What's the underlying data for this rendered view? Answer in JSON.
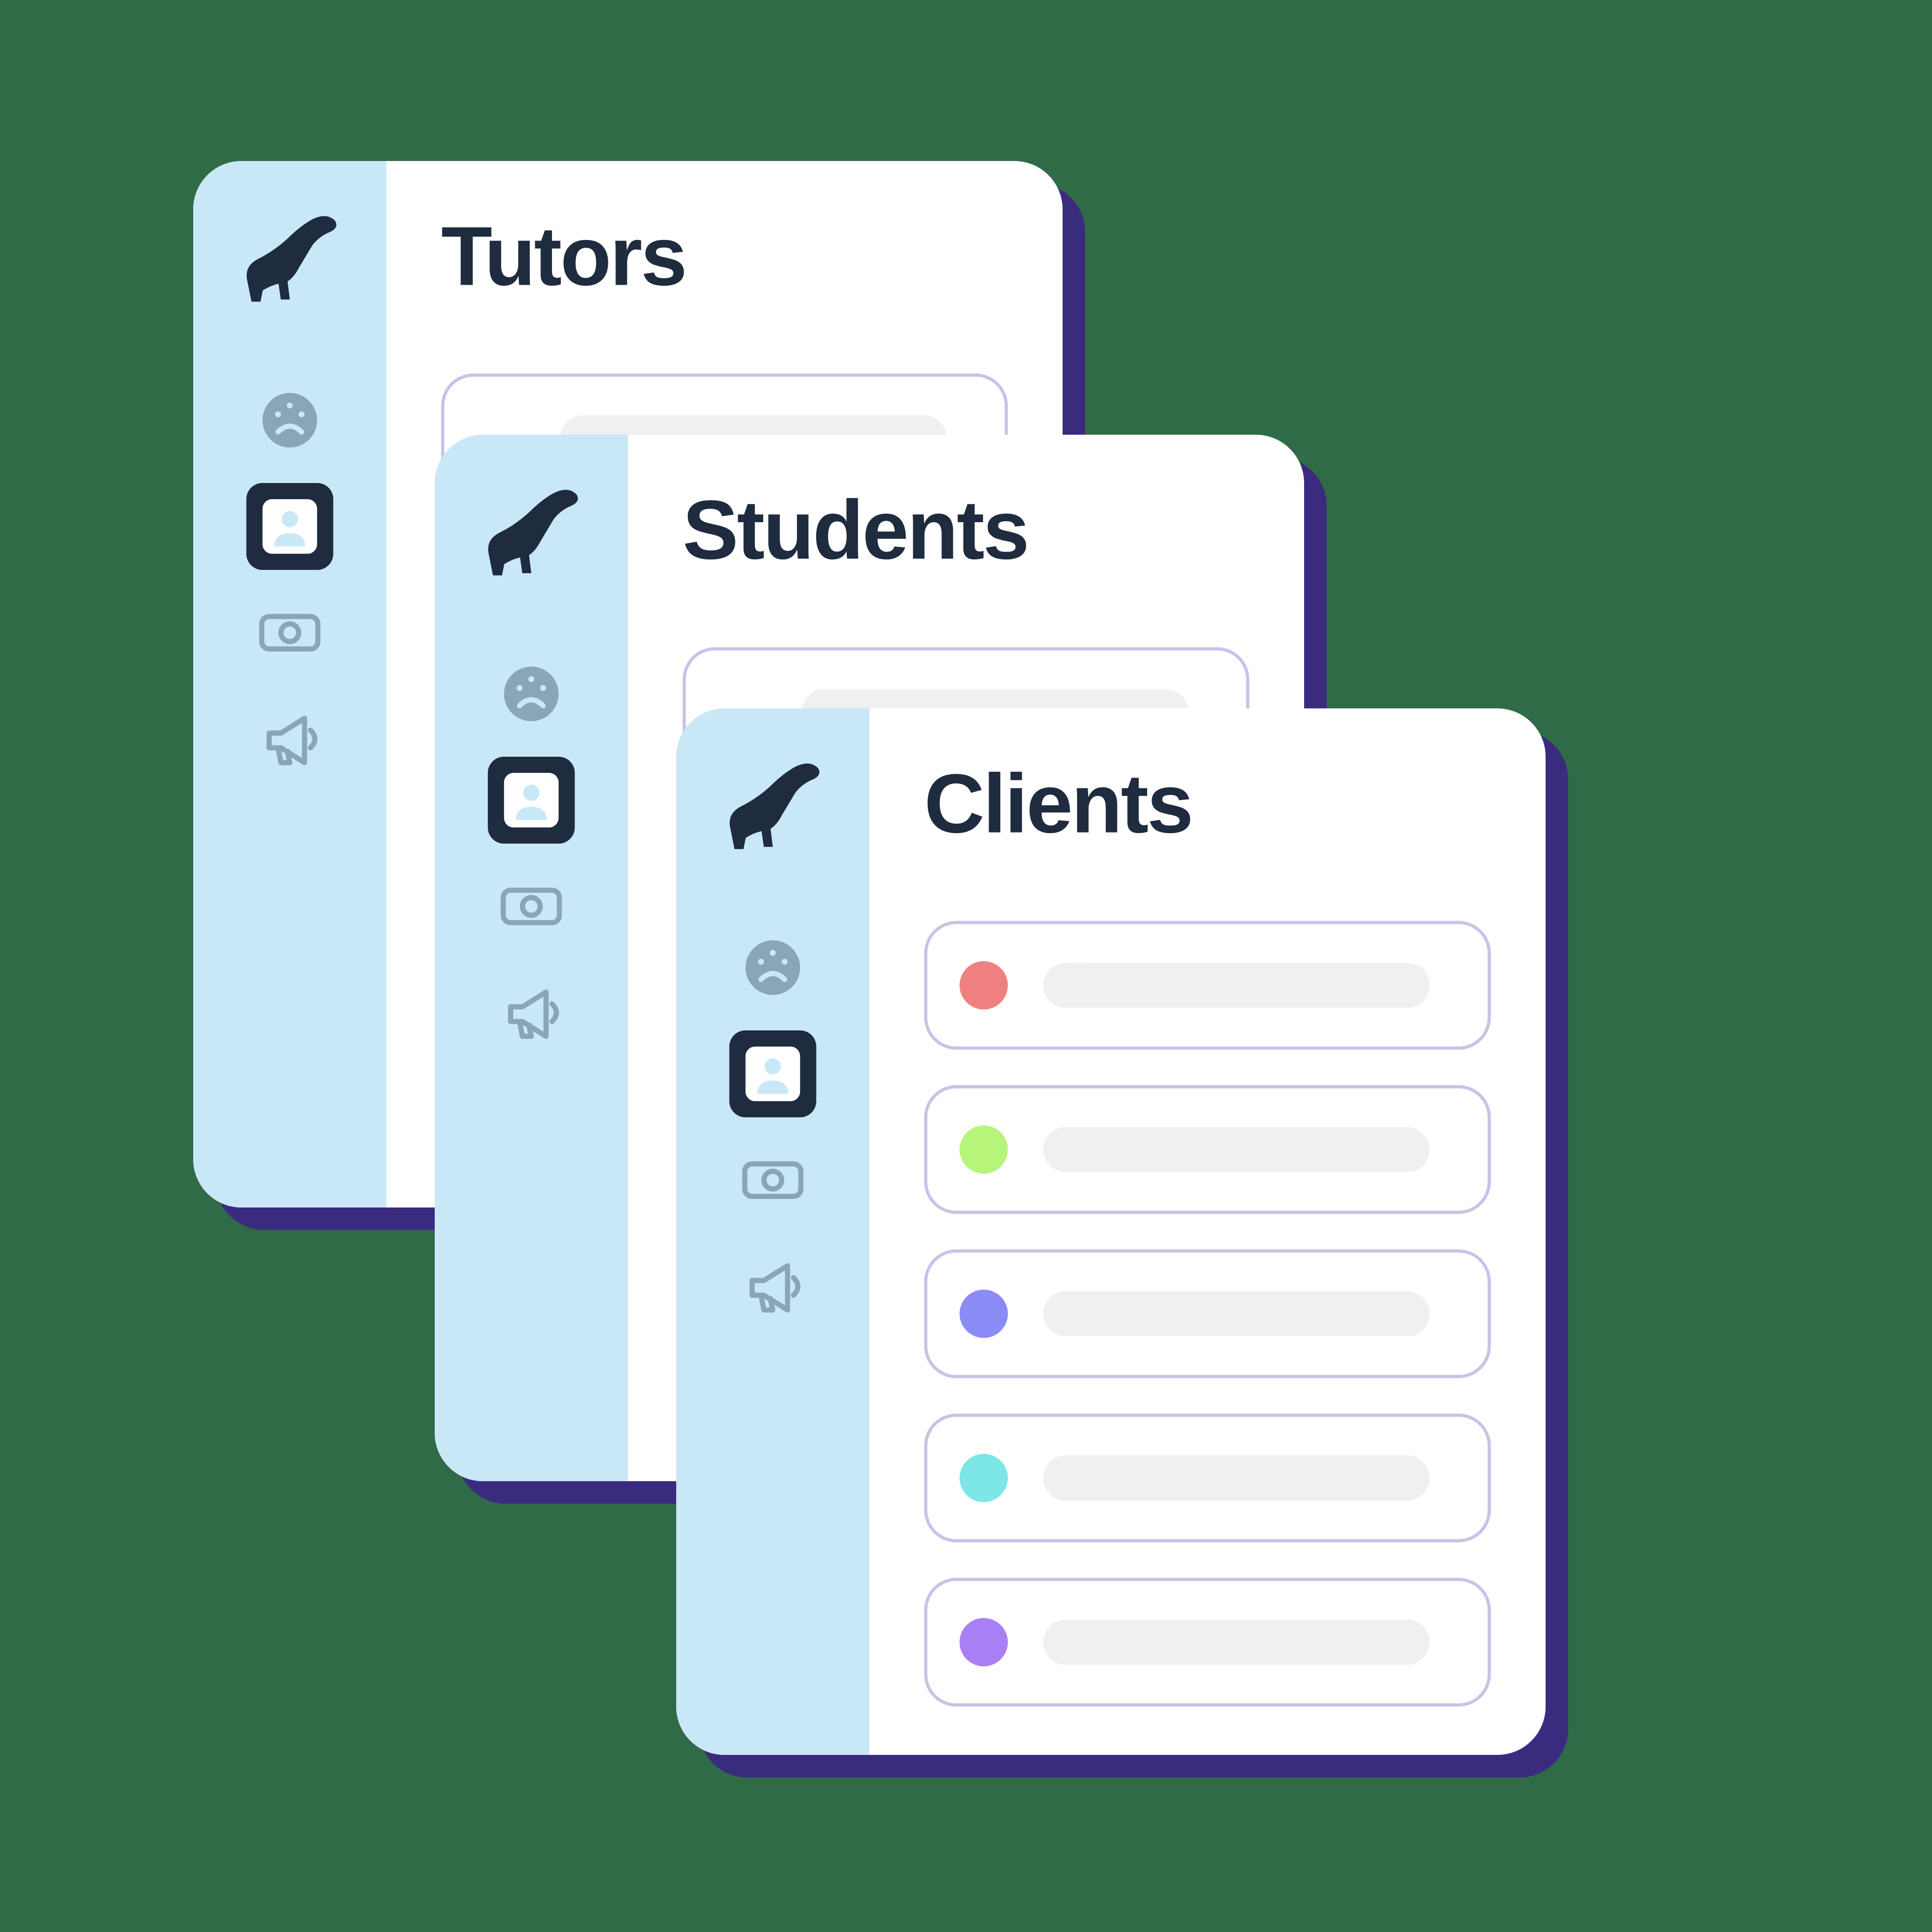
{
  "colors": {
    "bg": "#2f6b47",
    "cardShadow": "#3b2b7f",
    "sidebar": "#c9e8f7",
    "navActive": "#1f2b3e",
    "navInactive": "#8aa4b8",
    "title": "#1f2b3e",
    "rowBorder": "#c7c3e8",
    "bar": "#eef0f2"
  },
  "sidebar": {
    "logo": "dinosaur-logo",
    "items": [
      {
        "name": "dashboard",
        "icon": "gauge-icon",
        "active": false
      },
      {
        "name": "people",
        "icon": "user-icon",
        "active": true
      },
      {
        "name": "billing",
        "icon": "money-icon",
        "active": false
      },
      {
        "name": "announce",
        "icon": "megaphone-icon",
        "active": false
      }
    ]
  },
  "cards": {
    "back": {
      "title": "Tutors"
    },
    "mid": {
      "title": "Students"
    },
    "front": {
      "title": "Clients",
      "rows": [
        {
          "dotColor": "#f08080"
        },
        {
          "dotColor": "#b6f47a"
        },
        {
          "dotColor": "#8b8bf5"
        },
        {
          "dotColor": "#7de6e6"
        },
        {
          "dotColor": "#a97ff5"
        }
      ]
    }
  }
}
